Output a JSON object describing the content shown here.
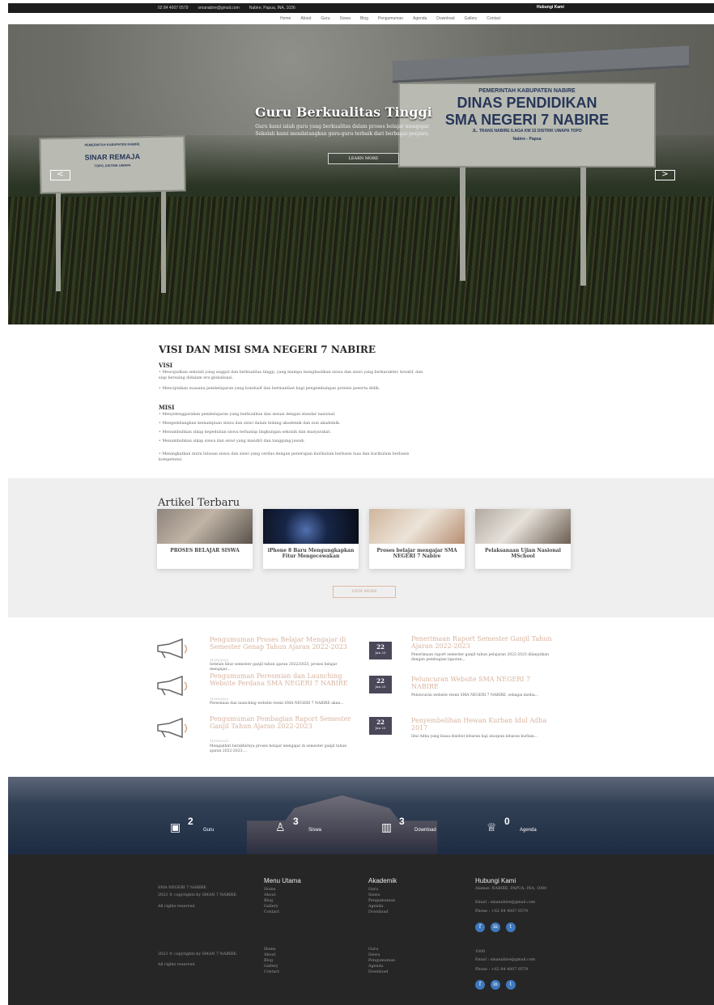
{
  "topbar": {
    "phone": "02 84 4007 0579",
    "email": "smanabire@gmail.com",
    "address": "Nabire, Papua, INA, 1036",
    "contact": "Hubungi Kami"
  },
  "nav": [
    "Home",
    "About",
    "Guru",
    "Siswa",
    "Blog",
    "Pengumuman",
    "Agenda",
    "Download",
    "Gallery",
    "Contact"
  ],
  "hero": {
    "title": "Guru Berkualitas Tinggi",
    "subtitle": "Guru kami ialah guru yang berkualitas dalam proses belajar mengajar. Sekolah kami mendatangkan guru-guru terbaik dari berbagai penjuru.",
    "button": "LEARN MORE",
    "left": "<",
    "right": ">",
    "sign_left": [
      "PEMERINTAH KABUPATEN NABIRE",
      "SINAR REMAJA",
      "TOPO, DISTRIK UWAPA"
    ],
    "sign_right": [
      "PEMERINTAH KABUPATEN NABIRE",
      "DINAS PENDIDIKAN",
      "SMA NEGERI 7 NABIRE",
      "JL. TRANS NABIRE ILAGA KM 32 DISTRIK UWAPA TOPO",
      "Nabire - Papua"
    ]
  },
  "visi": {
    "title": "VISI DAN MISI SMA NEGERI 7 NABIRE",
    "visi_head": "VISI",
    "visi_lines": [
      "• Mewujudkan sekolah yang unggul dan berkualitas tinggi, yang mampu menghasilkan siswa dan siswi yang berkarakter, kreatif, dan siap bersaing didalam era globalisasi.",
      "• Menciptakan suasana pembelajaran yang kondusif dan bermanfaat bagi pengembangan potensi peserta didik."
    ],
    "misi_head": "MISI",
    "misi_lines": [
      "• Menyelenggarakan pembelajaran yang berkualitas dan sesuai dengan standar nasional.",
      "• Mengembangkan kemampuan siswa dan siswi dalam bidang akademik dan non akademik.",
      "• Menumbuhkan sikap kepedulian siswa terhadap lingkungan sekolah dan masyarakat.",
      "• Menumbuhkan sikap siswa dan siswi yang mandiri dan tanggung jawab.",
      "• Meningkatkan mutu lulusan siswa dan siswi yang cerdas dengan penerapan kurikulum berbasis luas dan kurikulum berbasis kompetensi."
    ]
  },
  "articles": {
    "title": "Artikel Terbaru",
    "items": [
      "PROSES BELAJAR SISWA",
      "iPhone 8 Baru Mengungkapkan Fitur Mengecewakan",
      "Proses belajar mengajar SMA NEGERI 7 Nabire",
      "Pelaksanaan Ujian Nasional MSchool"
    ],
    "button": "VIEW MORE"
  },
  "news_left": [
    {
      "title": "Pengumuman Proses Belajar Mengajar di Semester Genap Tahun Ajaran 2022-2023",
      "date": "11/01/2023",
      "desc": "Setelah libur semester ganjil tahun ajaran 2022/2023, proses belajar mengajar..."
    },
    {
      "title": "Pengumuman Peresmian dan Launching Website Perdana SMA NEGERI 7 NABIRE",
      "date": "11/01/2023",
      "desc": "Peresmian dan launching website resmi SMA NEGERI 7 NABIRE akan..."
    },
    {
      "title": "Pengumuman Pembagian Raport Semester Ganjil Tahun Ajaran 2022-2023",
      "date": "11/01/2023",
      "desc": "Mengakhiri berakhirnya proses belajar mengajar di semester ganjil tahun ajaran 2022-2023,..."
    }
  ],
  "news_right": [
    {
      "day": "22",
      "month": "Jan 23",
      "title": "Penerimaan Raport Semester Ganjil Tahun Ajaran 2022-2023",
      "desc": "Penerimaan raport semester ganjil tahun pelajaran 2022-2023 dilanjutkan dengan pembagian laporan..."
    },
    {
      "day": "22",
      "month": "Jan 23",
      "title": "Peluncuran Website SMA NEGERI 7 NABIRE",
      "desc": "Peluncuran website resmi SMA NEGERI 7 NABIRE, sebagai media..."
    },
    {
      "day": "22",
      "month": "Jan 23",
      "title": "Penyembelihan Hewan Kurban Idul Adha 2017",
      "desc": "Idul Adha yang biasa disebut lebaran haji ataupun lebaran kurban..."
    }
  ],
  "stats": [
    {
      "n": "2",
      "l": "Guru",
      "icon": "presentation-icon"
    },
    {
      "n": "3",
      "l": "Siswa",
      "icon": "people-icon"
    },
    {
      "n": "3",
      "l": "Download",
      "icon": "book-icon"
    },
    {
      "n": "0",
      "l": "Agenda",
      "icon": "trophy-icon"
    }
  ],
  "footer": {
    "brand": "SMA NEGERI 7 NABIRE",
    "copyright": "2023 © copyrights by SMAN 7 NABIRE.",
    "rights": "All rights reserved.",
    "menu_head": "Menu Utama",
    "menu": [
      "Home",
      "About",
      "Blog",
      "Gallery",
      "Contact"
    ],
    "akad_head": "Akademik",
    "akad": [
      "Guru",
      "Siswa",
      "Pengumuman",
      "Agenda",
      "Download"
    ],
    "contact_head": "Hubungi Kami",
    "address": "Alamat: NABIRE, PAPUA, INA, 1000",
    "email": "Email : smanabire@gmail.com",
    "phone": "Phone : +62 84 4007 0579",
    "copyright2": "2023 © copyrights by SMAN 7 NABIRE.",
    "menu2": [
      "Home",
      "About",
      "Blog",
      "Gallery",
      "Contact"
    ],
    "akad2": [
      "Guru",
      "Siswa",
      "Pengumuman",
      "Agenda",
      "Download"
    ],
    "address2": "1000",
    "email2": "Email : smanabire@gmail.com",
    "phone2": "Phone : +62 84 4007 0579",
    "social": [
      "f",
      "in",
      "t"
    ]
  }
}
